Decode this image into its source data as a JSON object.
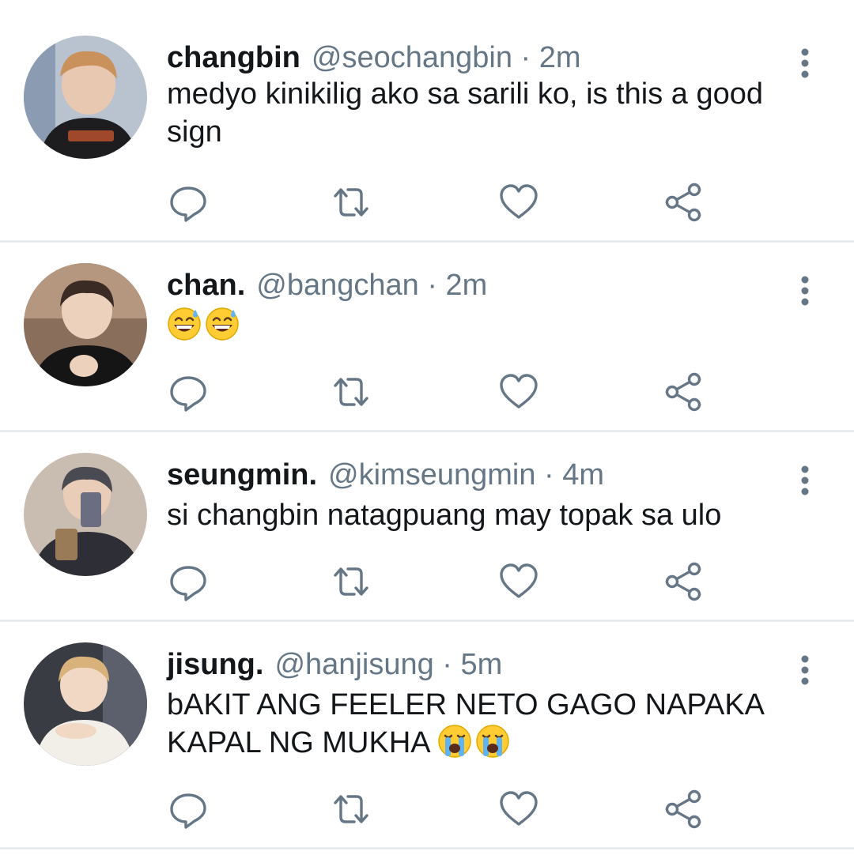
{
  "colors": {
    "text": "#14171a",
    "secondary": "#657786",
    "divider": "#e6ecf0",
    "icon": "#657786"
  },
  "tweets": [
    {
      "name": "changbin",
      "handle": "@seochangbin",
      "separator": "·",
      "time": "2m",
      "text": "medyo kinikilig ako sa sarili ko, is this a good sign",
      "emoji": []
    },
    {
      "name": "chan.",
      "handle": "@bangchan",
      "separator": "·",
      "time": "2m",
      "text": "",
      "emoji": [
        "grinning-face-with-sweat",
        "grinning-face-with-sweat"
      ]
    },
    {
      "name": "seungmin.",
      "handle": "@kimseungmin",
      "separator": "·",
      "time": "4m",
      "text": "si changbin natagpuang may topak sa ulo",
      "emoji": []
    },
    {
      "name": "jisung.",
      "handle": "@hanjisung",
      "separator": "·",
      "time": "5m",
      "text": "bAKIT ANG FEELER NETO GAGO NAPAKA KAPAL NG MUKHA",
      "emoji": [
        "loudly-crying-face",
        "loudly-crying-face"
      ]
    }
  ],
  "icons": {
    "reply": "reply-icon",
    "retweet": "retweet-icon",
    "like": "heart-icon",
    "share": "share-icon",
    "more": "more-vertical-icon"
  }
}
